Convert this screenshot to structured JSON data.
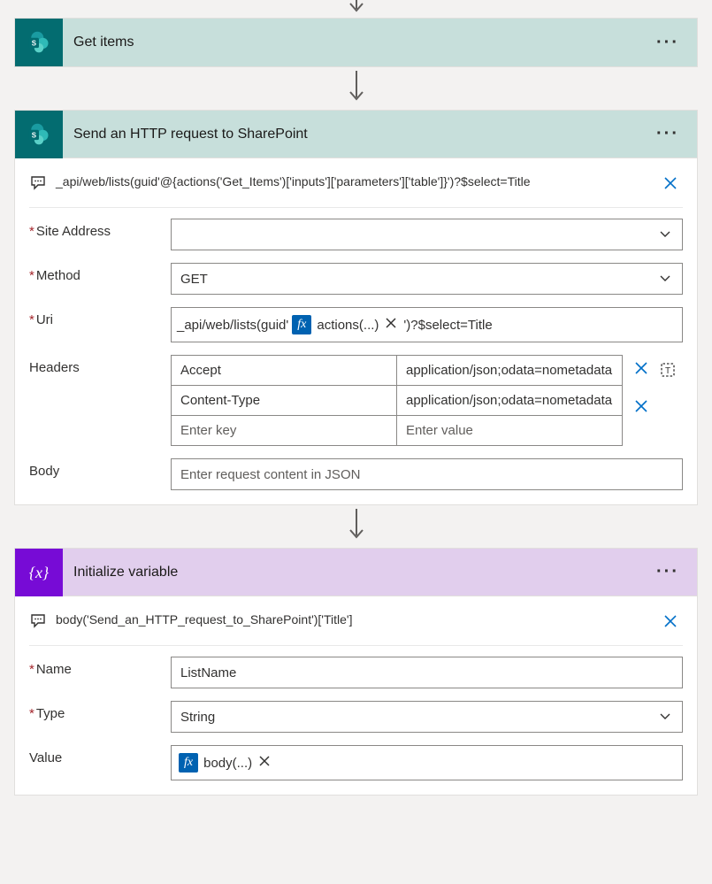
{
  "getItems": {
    "title": "Get items"
  },
  "httpReq": {
    "title": "Send an HTTP request to SharePoint",
    "comment": "_api/web/lists(guid'@{actions('Get_Items')['inputs']['parameters']['table']}')?$select=Title",
    "labels": {
      "siteAddress": "Site Address",
      "method": "Method",
      "uri": "Uri",
      "headers": "Headers",
      "body": "Body"
    },
    "methodValue": "GET",
    "uriPrefix": "_api/web/lists(guid'",
    "uriToken": "actions(...)",
    "uriSuffix": "')?$select=Title",
    "headersRows": [
      {
        "key": "Accept",
        "value": "application/json;odata=nometadata"
      },
      {
        "key": "Content-Type",
        "value": "application/json;odata=nometadata"
      }
    ],
    "headersKeyPlaceholder": "Enter key",
    "headersValuePlaceholder": "Enter value",
    "bodyPlaceholder": "Enter request content in JSON"
  },
  "initVar": {
    "title": "Initialize variable",
    "comment": "body('Send_an_HTTP_request_to_SharePoint')['Title']",
    "labels": {
      "name": "Name",
      "type": "Type",
      "value": "Value"
    },
    "nameValue": "ListName",
    "typeValue": "String",
    "valueToken": "body(...)"
  },
  "fx": "fx"
}
